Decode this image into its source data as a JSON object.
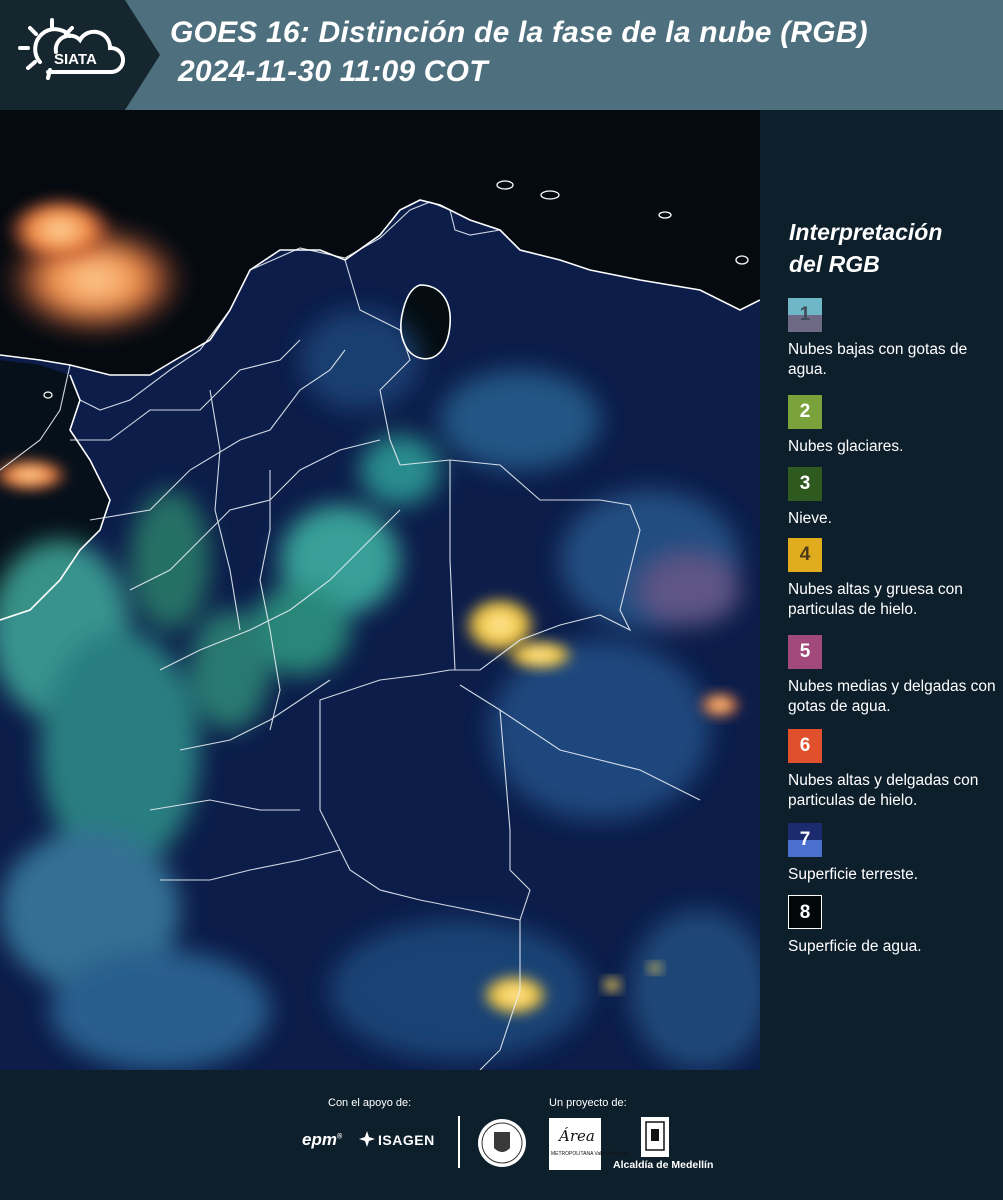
{
  "header": {
    "logo_text": "SIATA",
    "title_line1": "GOES 16: Distinción de la fase de la nube (RGB)",
    "title_line2": "2024-11-30 11:09 COT"
  },
  "legend": {
    "title_line1": "Interpretación",
    "title_line2": "del RGB",
    "items": [
      {
        "number": "1",
        "label": "Nubes bajas con gotas de agua.",
        "colors": [
          "#6fb6c6",
          "#6e6a86"
        ]
      },
      {
        "number": "2",
        "label": "Nubes glaciares.",
        "colors": [
          "#79a23a"
        ]
      },
      {
        "number": "3",
        "label": "Nieve.",
        "colors": [
          "#2e5a1f"
        ]
      },
      {
        "number": "4",
        "label": "Nubes altas y gruesa con particulas de hielo.",
        "colors": [
          "#e0ab1d"
        ]
      },
      {
        "number": "5",
        "label": "Nubes medias y delgadas con gotas de agua.",
        "colors": [
          "#a0497a"
        ]
      },
      {
        "number": "6",
        "label": "Nubes altas y delgadas con particulas de hielo.",
        "colors": [
          "#e0502a"
        ]
      },
      {
        "number": "7",
        "label": "Superficie terreste.",
        "colors": [
          "#1c2a6e",
          "#4a6fcf"
        ]
      },
      {
        "number": "8",
        "label": "Superficie de agua.",
        "colors": [
          "#02070a"
        ]
      }
    ]
  },
  "footer": {
    "support_label": "Con el apoyo de:",
    "project_label": "Un proyecto de:",
    "sponsor_1": "epm",
    "sponsor_2": "ISAGEN",
    "partner_area": "Área",
    "partner_area_sub": "METROPOLITANA Valle de Aburrá",
    "partner_alcaldia": "Alcaldía de Medellín"
  }
}
